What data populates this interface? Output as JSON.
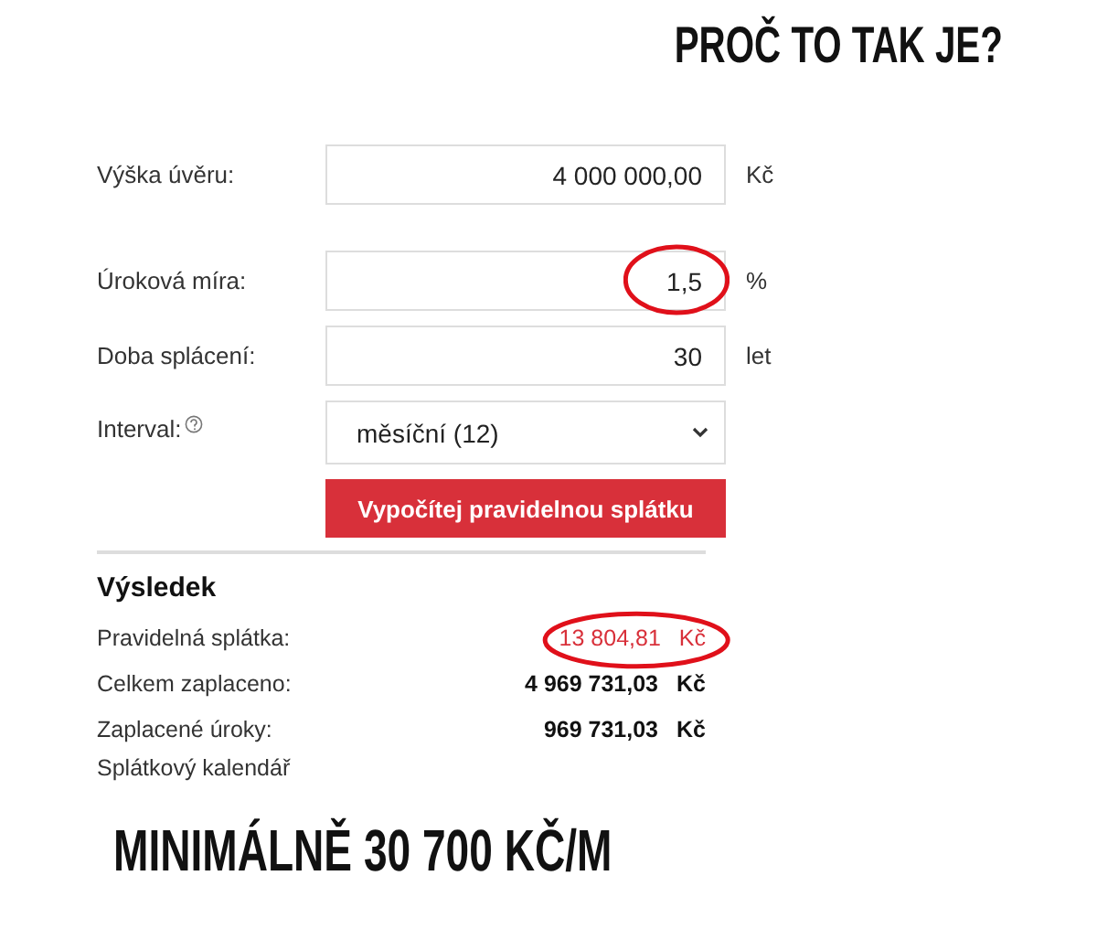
{
  "headline": "PROČ TO TAK JE?",
  "form": {
    "fields": [
      {
        "kind": "input",
        "label": "Výška úvěru:",
        "value": "4 000 000,00",
        "unit": "Kč",
        "highlighted": false,
        "help": false
      },
      {
        "kind": "input",
        "label": "Úroková míra:",
        "value": "1,5",
        "unit": "%",
        "highlighted": true,
        "help": false
      },
      {
        "kind": "input",
        "label": "Doba splácení:",
        "value": "30",
        "unit": "let",
        "highlighted": false,
        "help": false
      },
      {
        "kind": "select",
        "label": "Interval:",
        "value": "měsíční (12)",
        "highlighted": false,
        "help": true
      }
    ],
    "submit": "Vypočítej pravidelnou splátku"
  },
  "result": {
    "title": "Výsledek",
    "rows": [
      {
        "kind": "main",
        "label": "Pravidelná splátka:",
        "value": "13 804,81",
        "unit": "Kč",
        "highlighted": true
      },
      {
        "kind": "bold",
        "label": "Celkem zaplaceno:",
        "value": "4 969 731,03",
        "unit": "Kč",
        "highlighted": false
      },
      {
        "kind": "bold",
        "label": "Zaplacené úroky:",
        "value": "969 731,03",
        "unit": "Kč",
        "highlighted": false
      }
    ],
    "link": "Splátkový kalendář"
  },
  "footer_headline": "MINIMÁLNĚ 30 700 KČ/M"
}
